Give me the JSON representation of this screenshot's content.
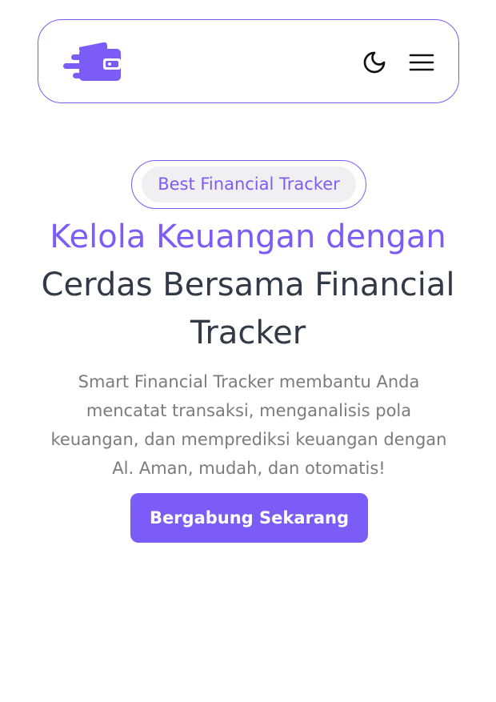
{
  "navbar": {
    "logo_icon": "wallet-speed-icon",
    "theme_icon": "moon-icon",
    "menu_icon": "hamburger-menu-icon"
  },
  "hero": {
    "badge": "Best Financial Tracker",
    "title_accent": "Kelola Keuangan dengan",
    "title_rest": "Cerdas Bersama Financial Tracker",
    "description": "Smart Financial Tracker membantu Anda mencatat transaksi, menganalisis pola keuangan, dan memprediksi keuangan dengan Al. Aman, mudah, dan otomatis!",
    "cta_label": "Bergabung Sekarang"
  },
  "colors": {
    "accent": "#7c5cf6",
    "heading": "#333a47",
    "body_text": "#7b7b7b",
    "badge_bg": "#f0f0f2"
  }
}
